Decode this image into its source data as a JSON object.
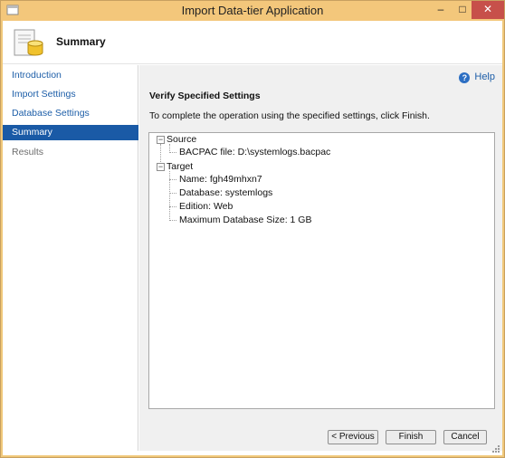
{
  "window": {
    "title": "Import Data-tier Application",
    "controls": {
      "minimize": "–",
      "maximize": "□",
      "close": "✕"
    },
    "accent": "#f3c77b",
    "close_color": "#c7504a"
  },
  "header": {
    "title": "Summary",
    "icon": "database-wizard-icon"
  },
  "sidebar": {
    "items": [
      {
        "label": "Introduction",
        "state": "link"
      },
      {
        "label": "Import Settings",
        "state": "link"
      },
      {
        "label": "Database Settings",
        "state": "link"
      },
      {
        "label": "Summary",
        "state": "active"
      },
      {
        "label": "Results",
        "state": "disabled"
      }
    ],
    "active_color": "#1a5aa6"
  },
  "help": {
    "label": "Help",
    "icon": "help-icon"
  },
  "main": {
    "section_title": "Verify Specified Settings",
    "instructions": "To complete the operation using the specified settings, click Finish."
  },
  "tree": {
    "source": {
      "label": "Source",
      "toggle": "−",
      "children": [
        "BACPAC file: D:\\systemlogs.bacpac"
      ]
    },
    "target": {
      "label": "Target",
      "toggle": "−",
      "children": [
        "Name: fgh49mhxn7",
        "Database: systemlogs",
        "Edition: Web",
        "Maximum Database Size: 1 GB"
      ]
    }
  },
  "buttons": {
    "previous": "< Previous",
    "finish": "Finish",
    "cancel": "Cancel"
  }
}
